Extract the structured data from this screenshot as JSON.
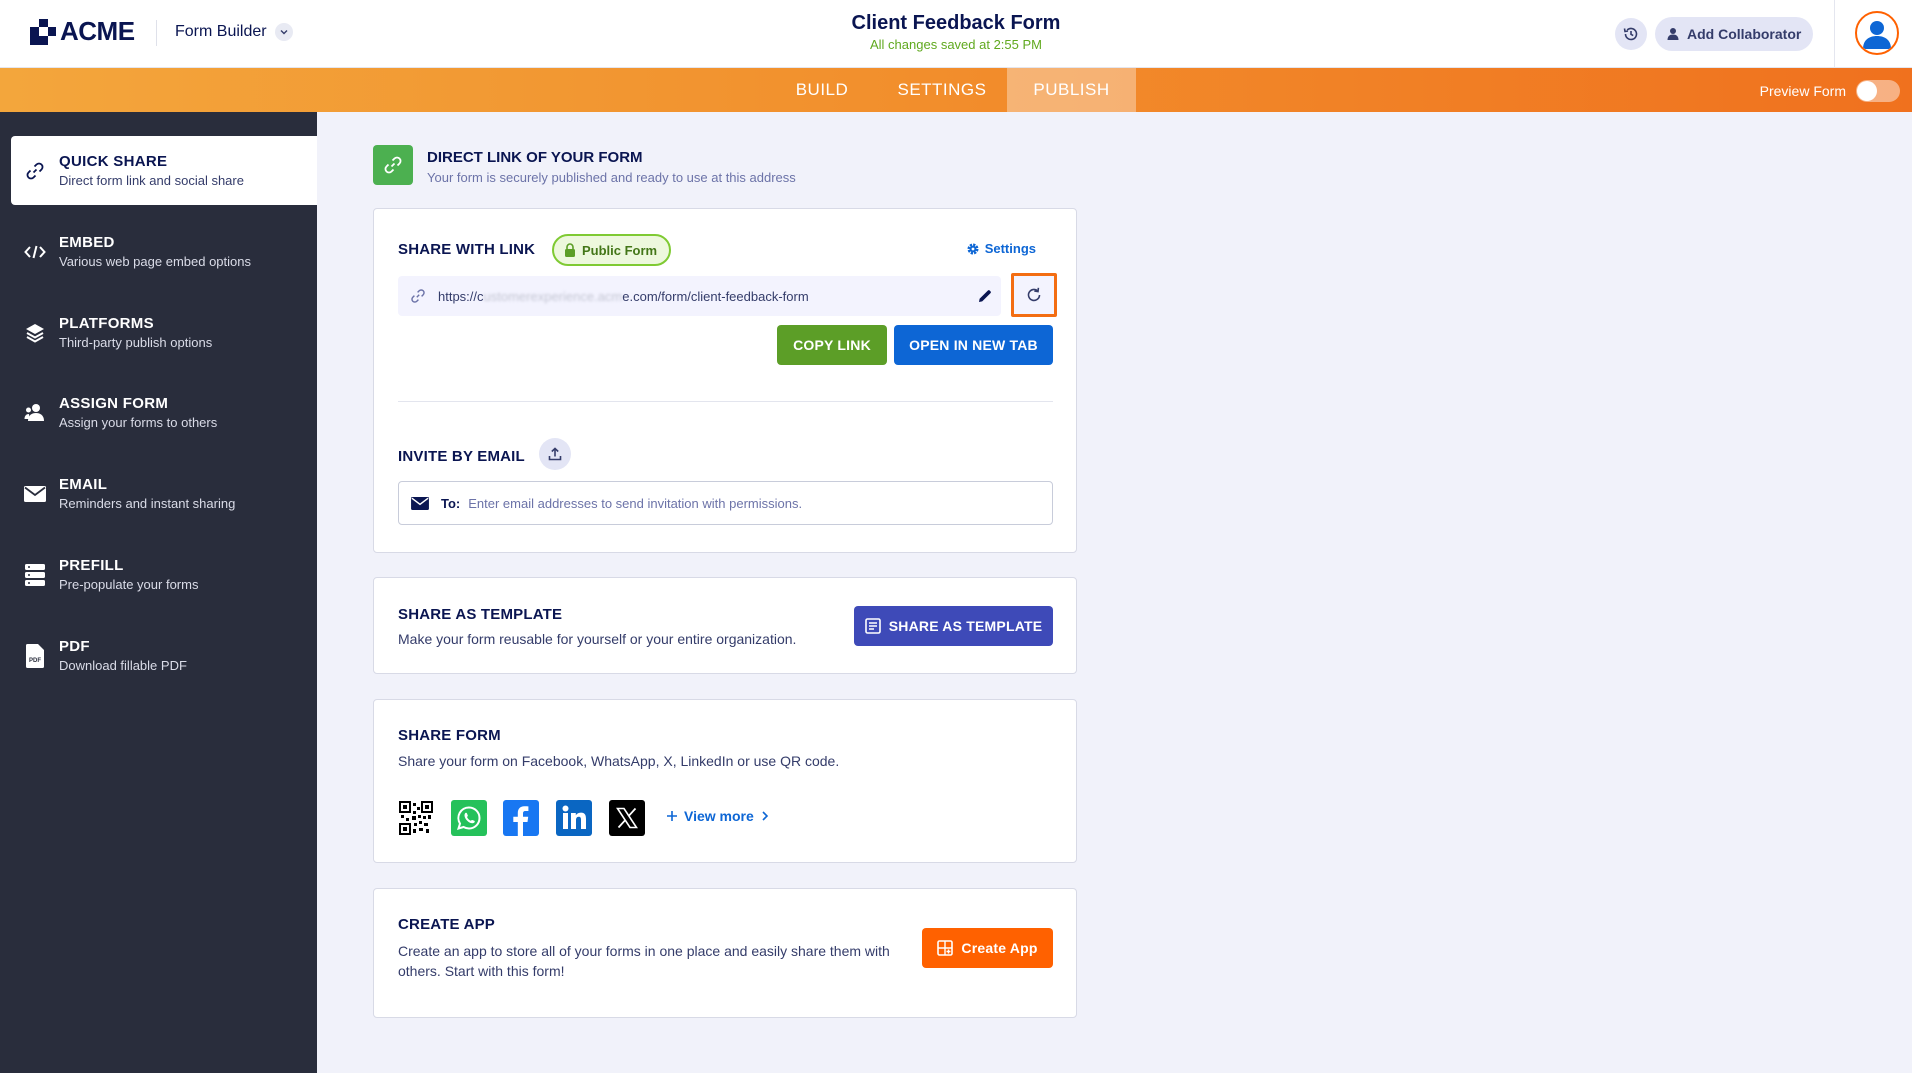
{
  "header": {
    "logo_text": "ACME",
    "builder_label": "Form Builder",
    "form_title": "Client Feedback Form",
    "save_status": "All changes saved at 2:55 PM",
    "collaborator_label": "Add Collaborator"
  },
  "nav": {
    "tabs": [
      {
        "label": "BUILD",
        "active": false
      },
      {
        "label": "SETTINGS",
        "active": false
      },
      {
        "label": "PUBLISH",
        "active": true
      }
    ],
    "preview_label": "Preview Form",
    "preview_enabled": false
  },
  "sidebar": {
    "items": [
      {
        "title": "QUICK SHARE",
        "subtitle": "Direct form link and social share",
        "icon": "link-icon",
        "active": true
      },
      {
        "title": "EMBED",
        "subtitle": "Various web page embed options",
        "icon": "code-icon",
        "active": false
      },
      {
        "title": "PLATFORMS",
        "subtitle": "Third-party publish options",
        "icon": "layers-icon",
        "active": false
      },
      {
        "title": "ASSIGN FORM",
        "subtitle": "Assign your forms to others",
        "icon": "users-icon",
        "active": false
      },
      {
        "title": "EMAIL",
        "subtitle": "Reminders and instant sharing",
        "icon": "envelope-icon",
        "active": false
      },
      {
        "title": "PREFILL",
        "subtitle": "Pre-populate your forms",
        "icon": "database-icon",
        "active": false
      },
      {
        "title": "PDF",
        "subtitle": "Download fillable PDF",
        "icon": "pdf-file-icon",
        "active": false
      }
    ]
  },
  "direct_link": {
    "title": "DIRECT LINK OF YOUR FORM",
    "subtitle": "Your form is securely published and ready to use at this address"
  },
  "share_link": {
    "title": "SHARE WITH LINK",
    "badge": "Public Form",
    "settings_label": "Settings",
    "url_prefix": "https://c",
    "url_blurred": "ustomerexperience.acm",
    "url_suffix": "e.com/form/client-feedback-form",
    "copy_label": "COPY LINK",
    "open_label": "OPEN IN NEW TAB"
  },
  "invite": {
    "title": "INVITE BY EMAIL",
    "to_label": "To:",
    "placeholder": "Enter email addresses to send invitation with permissions."
  },
  "template": {
    "title": "SHARE AS TEMPLATE",
    "description": "Make your form reusable for yourself or your entire organization.",
    "button_label": "SHARE AS TEMPLATE"
  },
  "share_form": {
    "title": "SHARE FORM",
    "description": "Share your form on Facebook, WhatsApp, X, LinkedIn or use QR code.",
    "networks": [
      "qr-code-icon",
      "whatsapp-icon",
      "facebook-icon",
      "linkedin-icon",
      "x-icon"
    ],
    "view_more_label": "View more"
  },
  "create_app": {
    "title": "CREATE APP",
    "description": "Create an app to store all of your forms in one place and easily share them with others. Start with this form!",
    "button_label": "Create App"
  },
  "colors": {
    "accent_orange": "#ff6100",
    "sidebar_bg": "#292d3c",
    "success_green": "#5c9e27",
    "primary_blue": "#0d66d5",
    "template_navy": "#3e4ab8"
  }
}
